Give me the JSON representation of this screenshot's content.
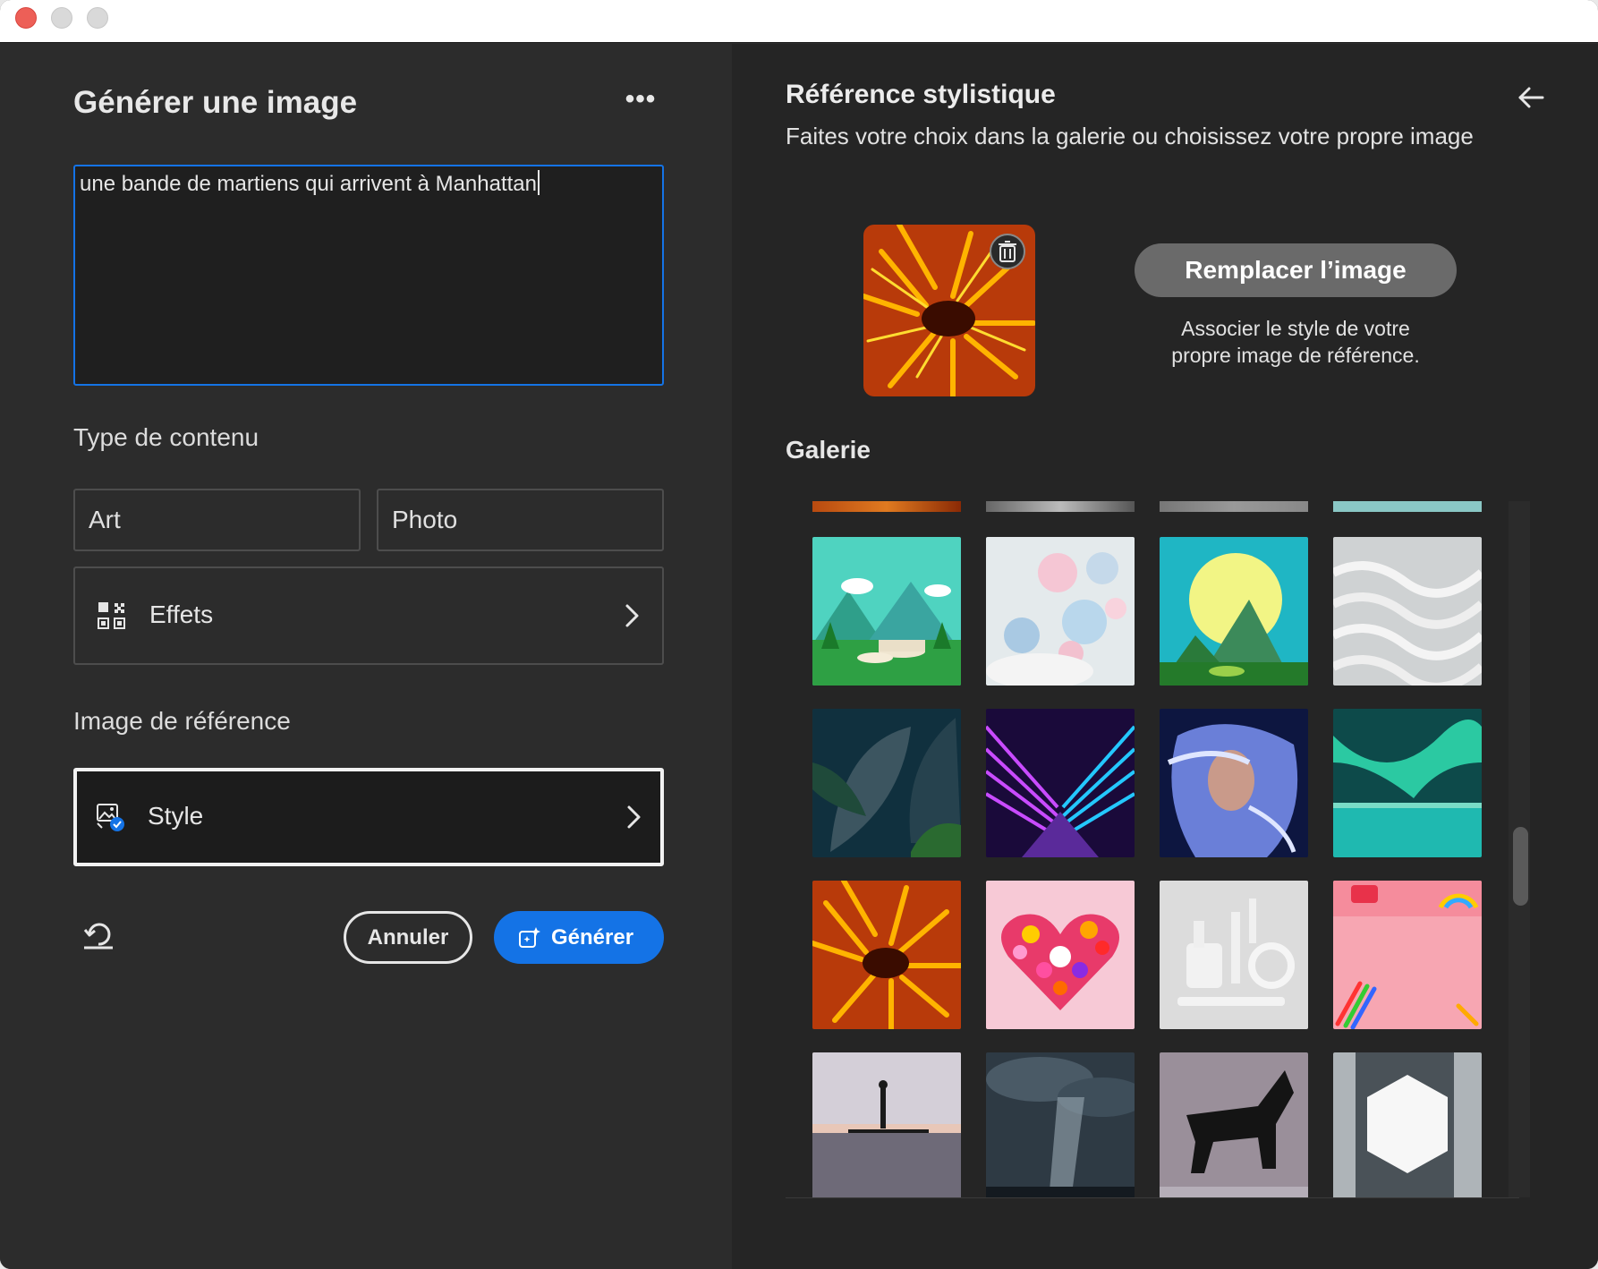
{
  "left_panel": {
    "title": "Générer une image",
    "more_label": "•••",
    "prompt_text": "une bande de martiens qui arrivent à Manhattan",
    "content_type_label": "Type de contenu",
    "type_options": [
      "Art",
      "Photo"
    ],
    "effects_label": "Effets",
    "reference_label": "Image de référence",
    "style_label": "Style",
    "cancel_label": "Annuler",
    "generate_label": "Générer"
  },
  "right_panel": {
    "title": "Référence stylistique",
    "subtitle": "Faites votre choix dans la galerie ou choisissez votre propre image",
    "replace_label": "Remplacer l’image",
    "associate_line1": "Associer le style de votre",
    "associate_line2": "propre image de référence.",
    "gallery_label": "Galerie"
  },
  "colors": {
    "accent": "#1473e6",
    "panel_left": "#2c2c2c",
    "panel_right": "#252525"
  },
  "gallery_tiles": [
    "stylized-landscape-podium",
    "pastel-spheres-clouds",
    "moon-over-valley",
    "white-waves-3d",
    "dark-leaves",
    "neon-corridor",
    "glowing-portrait",
    "aurora-lake",
    "orange-anemone",
    "flower-heart",
    "white-tools",
    "pink-desk-pencils",
    "sunset-paddleboard",
    "storm-clouds",
    "black-horse-sculpture",
    "white-hexagon"
  ]
}
